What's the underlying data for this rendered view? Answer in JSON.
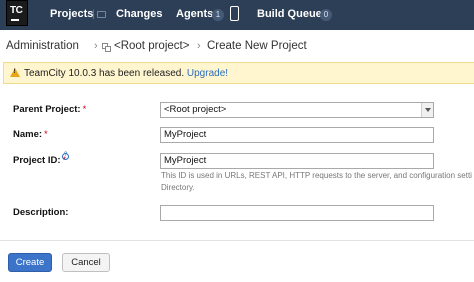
{
  "header": {
    "logo_text": "TC",
    "nav": [
      {
        "label": "Projects"
      },
      {
        "label": "Changes"
      },
      {
        "label": "Agents",
        "count": "1"
      },
      {
        "label": "Build Queue",
        "count": "0"
      }
    ]
  },
  "breadcrumb": {
    "items": [
      "Administration",
      "<Root project>",
      "Create New Project"
    ]
  },
  "notice": {
    "text": "TeamCity 10.0.3 has been released.",
    "link": "Upgrade!"
  },
  "form": {
    "parent_project": {
      "label": "Parent Project:",
      "value": "<Root project>"
    },
    "name": {
      "label": "Name:",
      "value": "MyProject"
    },
    "project_id": {
      "label": "Project ID:",
      "value": "MyProject",
      "note": "This ID is used in URLs, REST API, HTTP requests to the server, and configuration setti Directory."
    },
    "description": {
      "label": "Description:",
      "value": ""
    },
    "required_mark": "*"
  },
  "actions": {
    "create": "Create",
    "cancel": "Cancel"
  },
  "colors": {
    "header_bg": "#2c3f57",
    "primary": "#3b74c9",
    "notice_bg": "#fff6cf",
    "warning_icon": "#e9a514",
    "link": "#2a6ebd"
  }
}
